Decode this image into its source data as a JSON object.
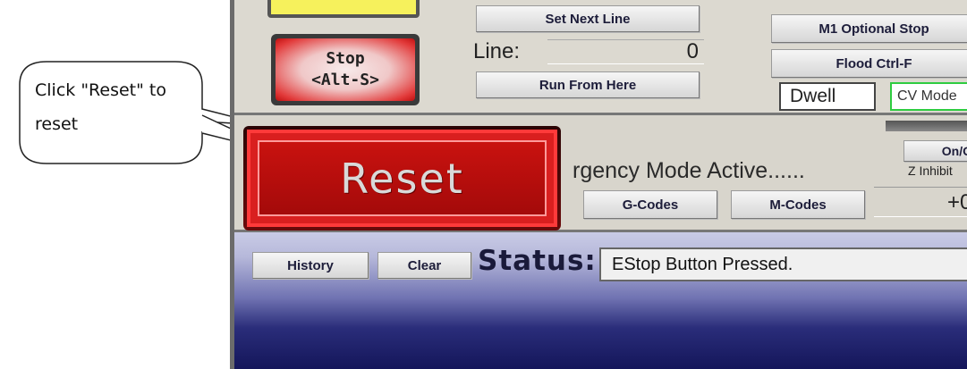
{
  "callout": {
    "line1": "Click \"Reset\" to",
    "line2": "reset"
  },
  "top": {
    "stop_line1": "Stop",
    "stop_line2": "<Alt-S>",
    "set_next_line": "Set Next Line",
    "line_label": "Line:",
    "line_value": "0",
    "run_from_here": "Run From Here",
    "m1_optional_stop": "M1 Optional Stop",
    "flood": "Flood Ctrl-F",
    "dwell": "Dwell",
    "cv_mode": "CV Mode"
  },
  "mid": {
    "reset": "Reset",
    "emergency_text": "rgency Mode Active......",
    "gcodes": "G-Codes",
    "mcodes": "M-Codes",
    "onoff": "On/O",
    "z_inhibit": "Z Inhibit",
    "value": "+0."
  },
  "status": {
    "history": "History",
    "clear": "Clear",
    "label": "Status:",
    "message": "EStop Button Pressed."
  },
  "colors": {
    "reset_red": "#c9120f",
    "panel_gray": "#dcd9d0",
    "status_blue": "#2a2d7a",
    "cv_green": "#2ecc40"
  }
}
